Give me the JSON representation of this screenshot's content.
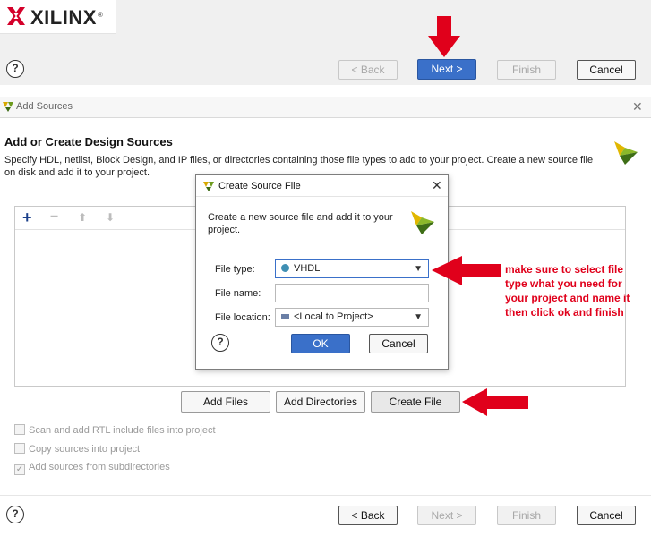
{
  "brand": {
    "name": "XILINX",
    "reg": "®"
  },
  "wizard_nav": {
    "help": "?",
    "back": "< Back",
    "next": "Next >",
    "finish": "Finish",
    "cancel": "Cancel"
  },
  "dialog": {
    "title": "Add Sources",
    "close": "✕",
    "section_title": "Add or Create Design Sources",
    "description": "Specify HDL, netlist, Block Design, and IP files, or directories containing those file types to add to your project. Create a new source file on disk and add it to your project.",
    "toolbar": {
      "add": "+",
      "remove": "−",
      "up": "⬆",
      "down": "⬇"
    },
    "panel_buttons": {
      "add_files": "Add Files",
      "add_directories": "Add Directories",
      "create_file": "Create File"
    },
    "options": [
      {
        "label": "Scan and add RTL include files into project",
        "checked": false
      },
      {
        "label": "Copy sources into project",
        "checked": false
      },
      {
        "label": "Add sources from subdirectories",
        "checked": true
      }
    ],
    "footer": {
      "help": "?",
      "back": "< Back",
      "next": "Next >",
      "finish": "Finish",
      "cancel": "Cancel"
    }
  },
  "modal": {
    "title": "Create Source File",
    "close": "✕",
    "description": "Create a new source file and add it to your project.",
    "file_type_label": "File type:",
    "file_type_value": "VHDL",
    "file_name_label": "File name:",
    "file_name_value": "",
    "file_location_label": "File location:",
    "file_location_value": "<Local to Project>",
    "help": "?",
    "ok": "OK",
    "cancel": "Cancel"
  },
  "annotation": {
    "text": "make sure to select file type what you need for your project  and name it then click ok and finish",
    "color": "#e0001b"
  },
  "colors": {
    "accent": "#3a70c9",
    "arrow": "#e0001b",
    "vhdl_dot": "#3f8fb3"
  }
}
